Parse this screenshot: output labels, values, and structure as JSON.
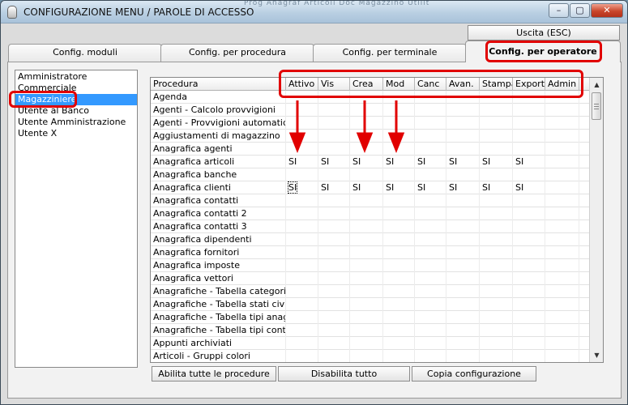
{
  "window": {
    "title": "CONFIGURAZIONE MENU / PAROLE DI ACCESSO",
    "background_menu_ghost": "Prog   Anagraf  Articoli  Doc  Magazzino  Utilit",
    "controls": {
      "minimize": "–",
      "maximize": "▢",
      "close": "✕"
    }
  },
  "toolbar": {
    "exit_label": "Uscita (ESC)"
  },
  "tabs": [
    {
      "label": "Config. moduli",
      "active": false
    },
    {
      "label": "Config. per procedura",
      "active": false
    },
    {
      "label": "Config. per terminale",
      "active": false
    },
    {
      "label": "Config. per operatore",
      "active": true
    }
  ],
  "operators": {
    "selected_index": 2,
    "items": [
      "Amministratore",
      "Commerciale",
      "Magazziniere",
      "Utente al Banco",
      "Utente Amministrazione",
      "Utente X"
    ]
  },
  "grid": {
    "columns": [
      "Procedura",
      "Attivo",
      "Vis",
      "Crea",
      "Mod",
      "Canc",
      "Avan.",
      "Stampa",
      "Export",
      "Admin"
    ],
    "focused_cell": {
      "row": 7,
      "col": 1
    },
    "rows": [
      [
        "Agenda",
        "",
        "",
        "",
        "",
        "",
        "",
        "",
        "",
        ""
      ],
      [
        "Agenti - Calcolo provvigioni",
        "",
        "",
        "",
        "",
        "",
        "",
        "",
        "",
        ""
      ],
      [
        "Agenti - Provvigioni automatiche",
        "",
        "",
        "",
        "",
        "",
        "",
        "",
        "",
        ""
      ],
      [
        "Aggiustamenti di magazzino",
        "",
        "",
        "",
        "",
        "",
        "",
        "",
        "",
        ""
      ],
      [
        "Anagrafica agenti",
        "",
        "",
        "",
        "",
        "",
        "",
        "",
        "",
        ""
      ],
      [
        "Anagrafica articoli",
        "SI",
        "SI",
        "SI",
        "SI",
        "SI",
        "SI",
        "SI",
        "SI",
        ""
      ],
      [
        "Anagrafica banche",
        "",
        "",
        "",
        "",
        "",
        "",
        "",
        "",
        ""
      ],
      [
        "Anagrafica clienti",
        "SI",
        "SI",
        "SI",
        "SI",
        "SI",
        "SI",
        "SI",
        "SI",
        ""
      ],
      [
        "Anagrafica contatti",
        "",
        "",
        "",
        "",
        "",
        "",
        "",
        "",
        ""
      ],
      [
        "Anagrafica contatti 2",
        "",
        "",
        "",
        "",
        "",
        "",
        "",
        "",
        ""
      ],
      [
        "Anagrafica contatti 3",
        "",
        "",
        "",
        "",
        "",
        "",
        "",
        "",
        ""
      ],
      [
        "Anagrafica dipendenti",
        "",
        "",
        "",
        "",
        "",
        "",
        "",
        "",
        ""
      ],
      [
        "Anagrafica fornitori",
        "",
        "",
        "",
        "",
        "",
        "",
        "",
        "",
        ""
      ],
      [
        "Anagrafica imposte",
        "",
        "",
        "",
        "",
        "",
        "",
        "",
        "",
        ""
      ],
      [
        "Anagrafica vettori",
        "",
        "",
        "",
        "",
        "",
        "",
        "",
        "",
        ""
      ],
      [
        "Anagrafiche - Tabella categorie",
        "",
        "",
        "",
        "",
        "",
        "",
        "",
        "",
        ""
      ],
      [
        "Anagrafiche - Tabella stati civili",
        "",
        "",
        "",
        "",
        "",
        "",
        "",
        "",
        ""
      ],
      [
        "Anagrafiche - Tabella tipi anagrafic",
        "",
        "",
        "",
        "",
        "",
        "",
        "",
        "",
        ""
      ],
      [
        "Anagrafiche - Tabella tipi contatti",
        "",
        "",
        "",
        "",
        "",
        "",
        "",
        "",
        ""
      ],
      [
        "Appunti archiviati",
        "",
        "",
        "",
        "",
        "",
        "",
        "",
        "",
        ""
      ],
      [
        "Articoli - Gruppi colori",
        "",
        "",
        "",
        "",
        "",
        "",
        "",
        "",
        ""
      ]
    ]
  },
  "actions": {
    "enable_all": "Abilita tutte le procedure",
    "disable_all": "Disabilita tutto",
    "copy_config": "Copia configurazione"
  },
  "annotation_color": "#e10000"
}
